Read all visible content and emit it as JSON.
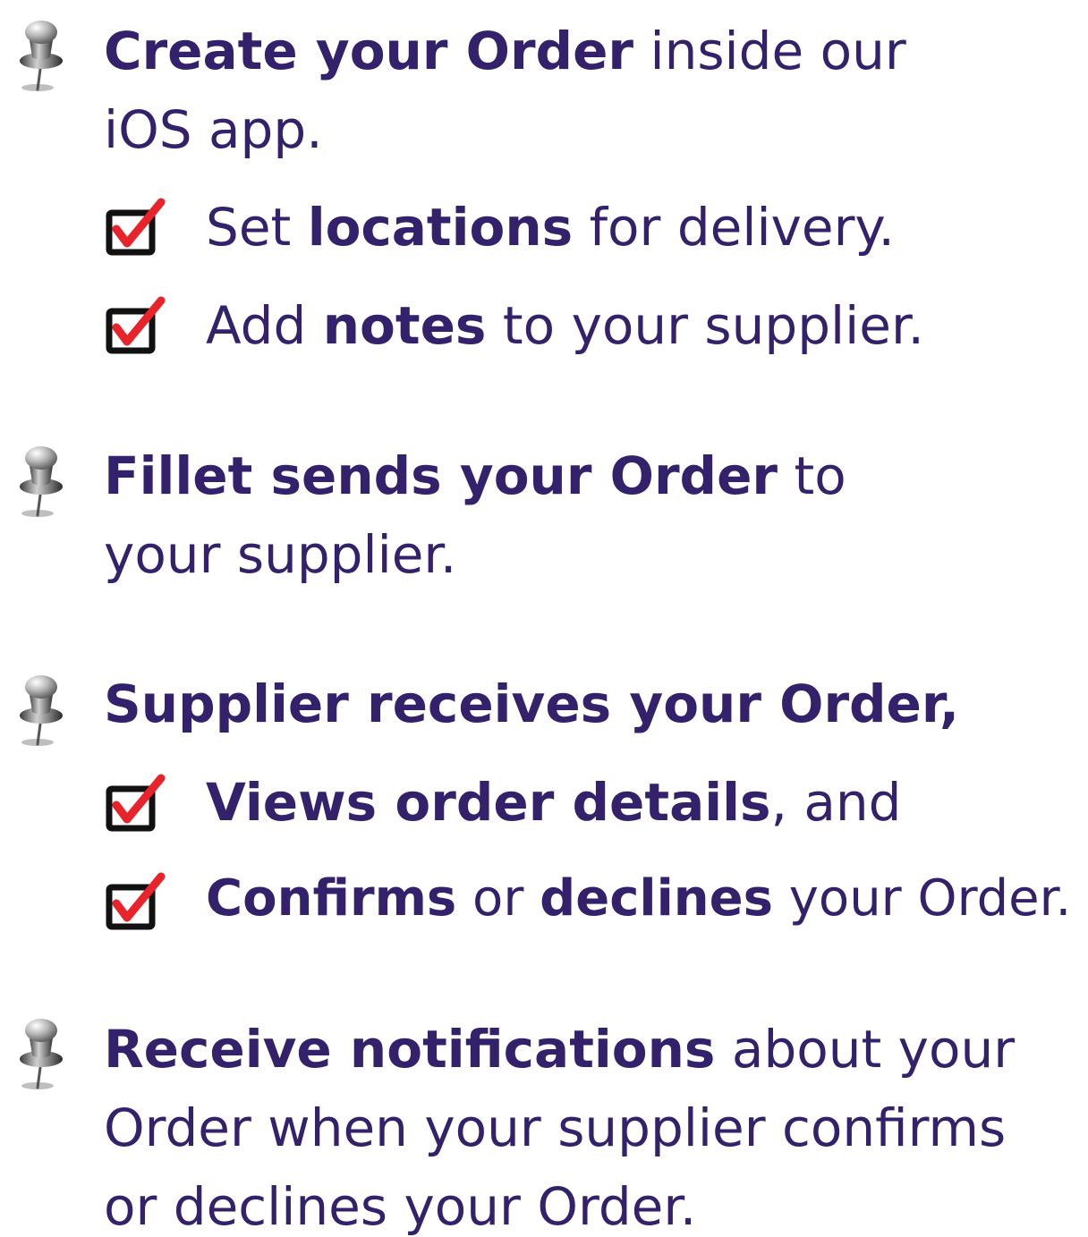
{
  "colors": {
    "text": "#34216b",
    "check_red": "#e8232a",
    "check_box": "#111111"
  },
  "icons": {
    "bullet": "pushpin-icon",
    "sub_bullet": "checked-checkbox-icon"
  },
  "steps": [
    {
      "line1": {
        "bold": "Create your Order",
        "rest": " inside our"
      },
      "line2": "iOS app.",
      "subs": [
        {
          "pre": "Set ",
          "bold": "locations",
          "post": " for delivery."
        },
        {
          "pre": "Add ",
          "bold": "notes",
          "post": " to your supplier."
        }
      ]
    },
    {
      "line1": {
        "bold": "Fillet sends your Order",
        "rest": " to"
      },
      "line2": "your supplier."
    },
    {
      "line1": {
        "bold": "Supplier receives your Order,",
        "rest": ""
      },
      "subs": [
        {
          "bold": "Views order details",
          "post": ", and"
        },
        {
          "bold": "Confirms",
          "mid": " or ",
          "bold2": "declines",
          "post": " your Order."
        }
      ]
    },
    {
      "line1": {
        "bold": "Receive notifications",
        "rest": " about your"
      },
      "line2": "Order when your supplier confirms",
      "line3": "or declines your Order."
    }
  ]
}
